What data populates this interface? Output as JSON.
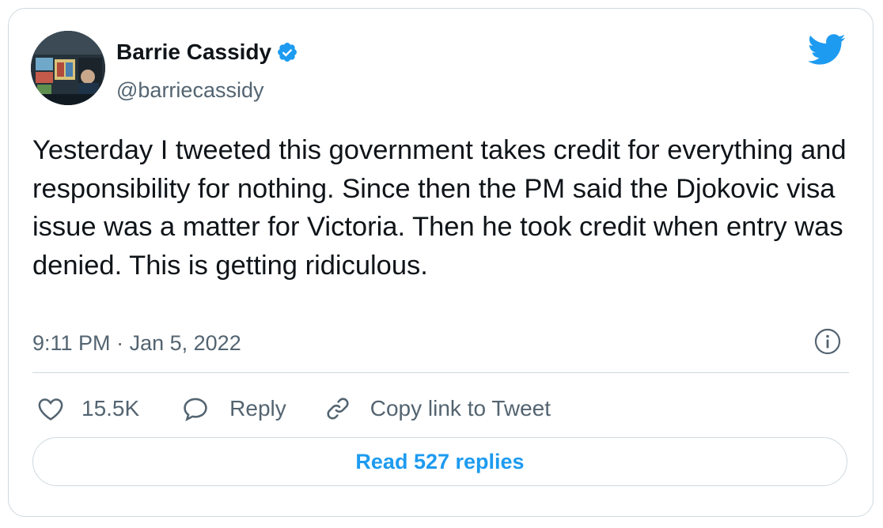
{
  "author": {
    "display_name": "Barrie Cassidy",
    "handle": "@barriecassidy",
    "verified": true,
    "avatar_icon": "profile-photo"
  },
  "brand": {
    "icon": "twitter-bird-icon",
    "color": "#1d9bf0"
  },
  "tweet": {
    "text": "Yesterday I tweeted this government takes credit for everything and responsibility for nothing. Since then the PM said the Djokovic visa issue was a matter for Victoria. Then he took credit when entry was denied. This is getting ridiculous.",
    "time": "9:11 PM",
    "separator": "·",
    "date": "Jan 5, 2022"
  },
  "actions": {
    "like_count": "15.5K",
    "reply_label": "Reply",
    "copy_link_label": "Copy link to Tweet"
  },
  "read_replies_label": "Read 527 replies",
  "colors": {
    "text_primary": "#0f1419",
    "text_secondary": "#536471",
    "border": "#cfd9de",
    "accent": "#1d9bf0"
  }
}
